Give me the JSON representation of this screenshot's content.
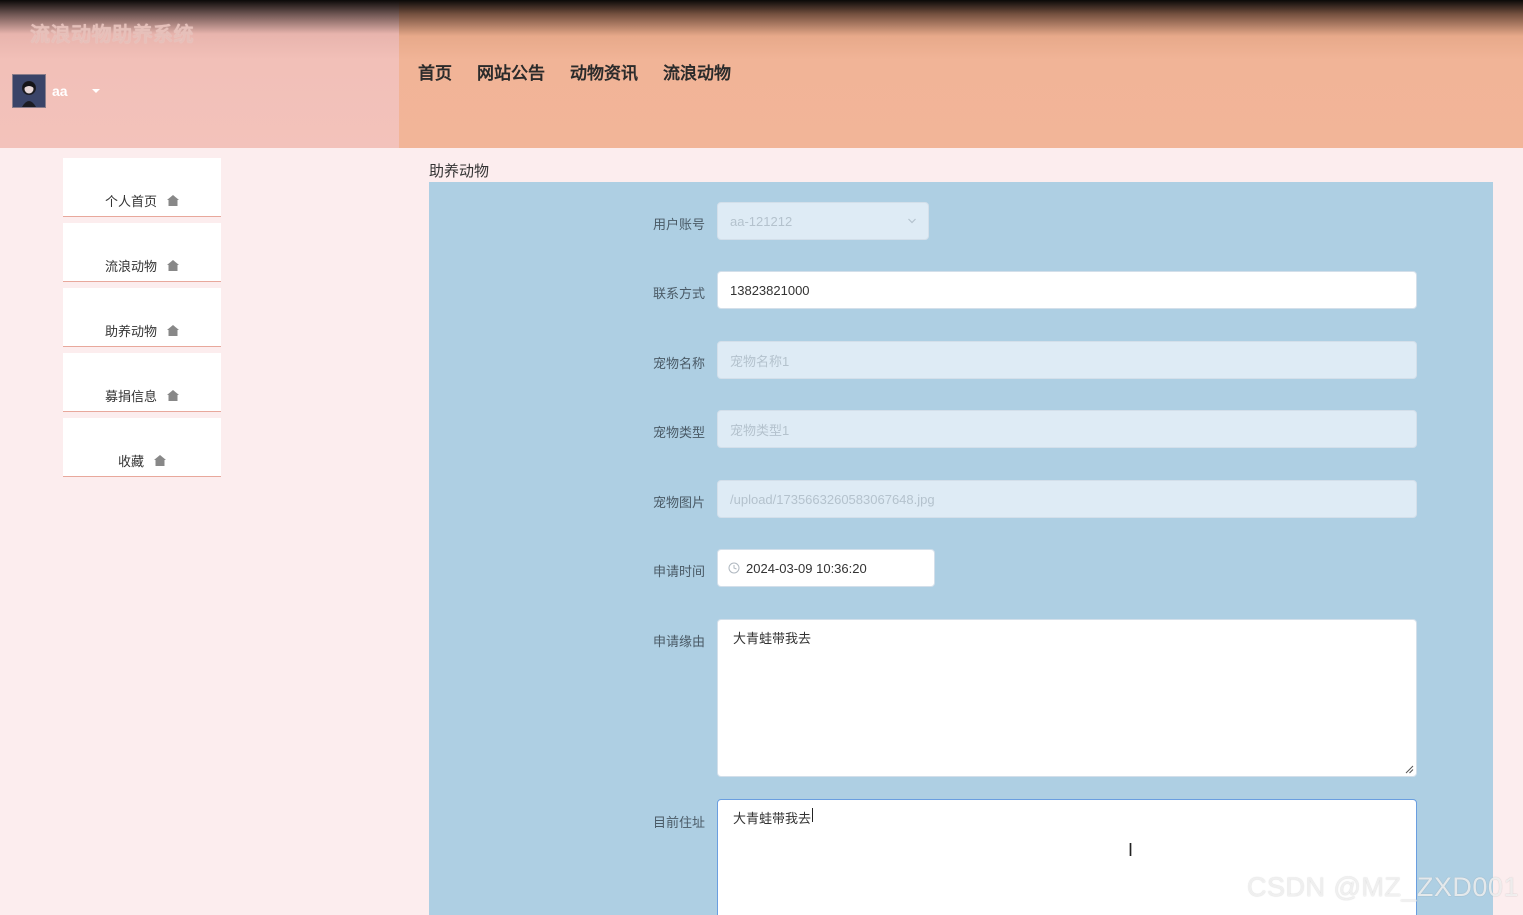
{
  "header": {
    "site_title": "流浪动物助养系统",
    "user_name": "aa",
    "nav": [
      "首页",
      "网站公告",
      "动物资讯",
      "流浪动物"
    ]
  },
  "sidebar": {
    "items": [
      {
        "label": "个人首页",
        "icon": "home-icon"
      },
      {
        "label": "流浪动物",
        "icon": "home-icon"
      },
      {
        "label": "助养动物",
        "icon": "home-icon"
      },
      {
        "label": "募捐信息",
        "icon": "home-icon"
      },
      {
        "label": "收藏",
        "icon": "home-icon"
      }
    ]
  },
  "main": {
    "section_title": "助养动物",
    "form": {
      "user_account": {
        "label": "用户账号",
        "value": "aa-121212"
      },
      "contact": {
        "label": "联系方式",
        "value": "13823821000"
      },
      "pet_name": {
        "label": "宠物名称",
        "value": "宠物名称1"
      },
      "pet_type": {
        "label": "宠物类型",
        "value": "宠物类型1"
      },
      "pet_image": {
        "label": "宠物图片",
        "value": "/upload/1735663260583067648.jpg"
      },
      "apply_time": {
        "label": "申请时间",
        "value": "2024-03-09 10:36:20"
      },
      "reason": {
        "label": "申请缘由",
        "value": "大青蛙带我去"
      },
      "address": {
        "label": "目前住址",
        "value": "大青蛙带我去"
      }
    }
  },
  "watermark": "CSDN @MZ_ZXD001",
  "colors": {
    "header_left": "#f3c2bb",
    "header_right": "#f2b598",
    "page_bg": "#fcedee",
    "form_panel": "#aecfe3",
    "sidebar_border": "#e8a89c"
  }
}
